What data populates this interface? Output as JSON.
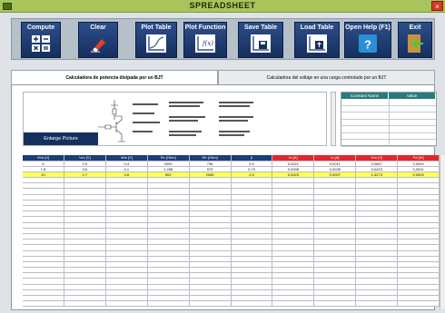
{
  "window": {
    "title": "SPREADSHEET",
    "close": "×"
  },
  "toolbar": {
    "compute": "Compute",
    "clear": "Clear",
    "plot_table": "Plot Table",
    "plot_function": "Plot Function",
    "plot_function_icon_text": "f(x)",
    "save_table": "Save Table",
    "load_table": "Load Table",
    "open_help": "Open Help (F1)",
    "help_icon_text": "?",
    "exit": "Exit"
  },
  "tabs": [
    {
      "label": "Calculadora de potencia disipada por un BJT"
    },
    {
      "label": "Calculadora del voltaje en una carga controlado por un BJT"
    }
  ],
  "diagram": {
    "enlarge": "Enlarge Picture"
  },
  "constants": {
    "name_header": "Constant Name",
    "value_header": "Value"
  },
  "table": {
    "headers": [
      "Vbb [V]",
      "Vcc [V]",
      "Vbe [V]",
      "Rc [Ohm]",
      "Rb [Ohm]",
      "β",
      "Ib [A]",
      "Ic [A]",
      "Vce [V]",
      "Pd [W]"
    ],
    "rows": [
      [
        "5",
        "2,5",
        "0,4",
        "2000",
        "798",
        "0,3",
        "0,0021",
        "0,0011",
        "0,0667",
        "0,0004"
      ],
      [
        "7,6",
        "3,6",
        "4,1",
        "1.258",
        "973",
        "0,73",
        "0,0008",
        "0,0028",
        "0,0423",
        "0,0001"
      ],
      [
        "10",
        "1,7",
        "3,8",
        "500",
        "2089",
        "0,3",
        "0,0023",
        "0,0007",
        "1,3273",
        "0,0009"
      ]
    ],
    "empty_rows": 23,
    "selected_row": 2
  },
  "colors": {
    "toolbar_blue": "#15305e",
    "header_blue": "#1b3d78",
    "header_red": "#e3262b",
    "selected_yellow": "#ffff55",
    "teal": "#2a7a7d"
  }
}
